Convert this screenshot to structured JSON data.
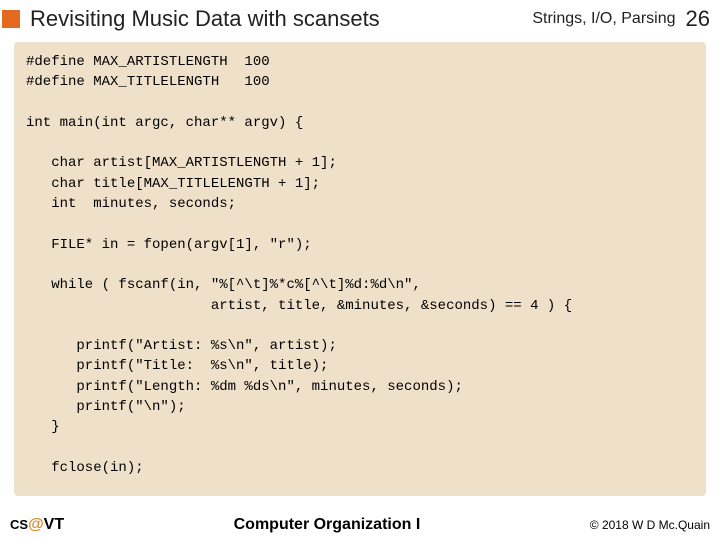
{
  "header": {
    "title": "Revisiting Music Data with scansets",
    "topic": "Strings, I/O, Parsing",
    "page": "26"
  },
  "code": "#define MAX_ARTISTLENGTH  100\n#define MAX_TITLELENGTH   100\n\nint main(int argc, char** argv) {\n\n   char artist[MAX_ARTISTLENGTH + 1];\n   char title[MAX_TITLELENGTH + 1];\n   int  minutes, seconds;\n\n   FILE* in = fopen(argv[1], \"r\");\n\n   while ( fscanf(in, \"%[^\\t]%*c%[^\\t]%d:%d\\n\",\n                      artist, title, &minutes, &seconds) == 4 ) {\n\n      printf(\"Artist: %s\\n\", artist);\n      printf(\"Title:  %s\\n\", title);\n      printf(\"Length: %dm %ds\\n\", minutes, seconds);\n      printf(\"\\n\");\n   }\n\n   fclose(in);",
  "footer": {
    "cs": "CS",
    "at": "@",
    "vt": "VT",
    "course": "Computer Organization I",
    "copyright": "© 2018 W D Mc.Quain"
  }
}
